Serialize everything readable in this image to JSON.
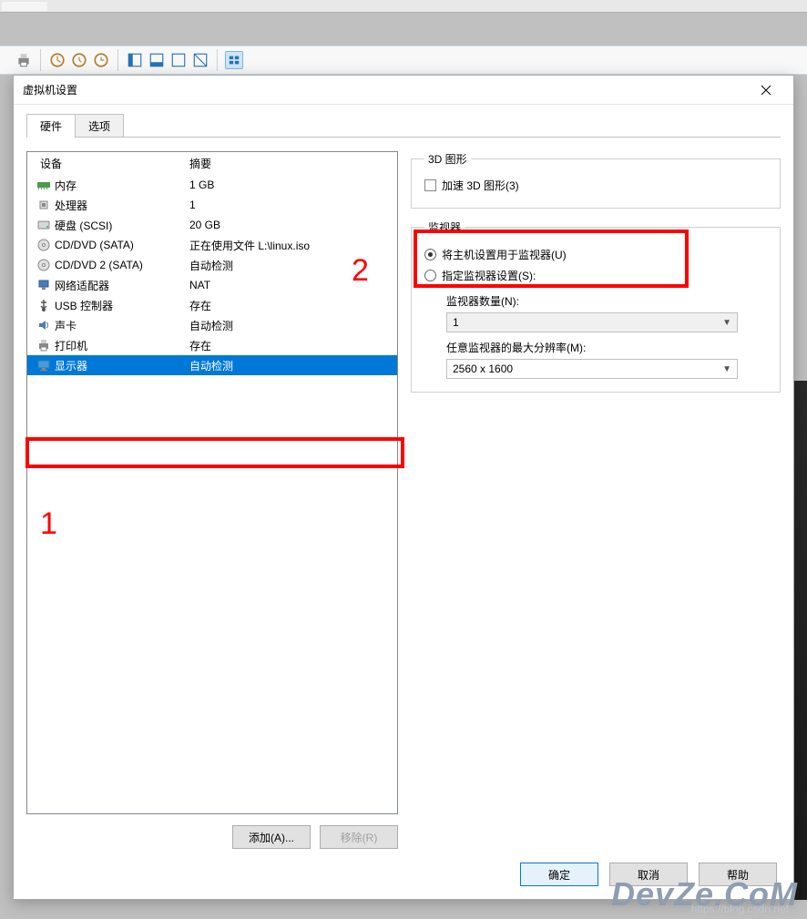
{
  "dialog": {
    "title": "虚拟机设置"
  },
  "tabs": {
    "hardware": "硬件",
    "options": "选项"
  },
  "headers": {
    "device": "设备",
    "summary": "摘要"
  },
  "devices": [
    {
      "name": "内存",
      "summary": "1 GB",
      "icon": "memory"
    },
    {
      "name": "处理器",
      "summary": "1",
      "icon": "cpu"
    },
    {
      "name": "硬盘 (SCSI)",
      "summary": "20 GB",
      "icon": "disk"
    },
    {
      "name": "CD/DVD (SATA)",
      "summary": "正在使用文件 L:\\linux.iso",
      "icon": "cd"
    },
    {
      "name": "CD/DVD 2 (SATA)",
      "summary": "自动检测",
      "icon": "cd"
    },
    {
      "name": "网络适配器",
      "summary": "NAT",
      "icon": "net"
    },
    {
      "name": "USB 控制器",
      "summary": "存在",
      "icon": "usb"
    },
    {
      "name": "声卡",
      "summary": "自动检测",
      "icon": "sound"
    },
    {
      "name": "打印机",
      "summary": "存在",
      "icon": "printer"
    },
    {
      "name": "显示器",
      "summary": "自动检测",
      "icon": "display",
      "selected": true
    }
  ],
  "buttons": {
    "add": "添加(A)...",
    "remove": "移除(R)",
    "ok": "确定",
    "cancel": "取消",
    "help": "帮助"
  },
  "graphics3d": {
    "legend": "3D 图形",
    "accel": "加速 3D 图形(3)"
  },
  "monitor": {
    "legend": "监视器",
    "use_host": "将主机设置用于监视器(U)",
    "specify": "指定监视器设置(S):",
    "count_label": "监视器数量(N):",
    "count_value": "1",
    "maxres_label": "任意监视器的最大分辨率(M):",
    "maxres_value": "2560 x 1600"
  },
  "annotations": {
    "one": "1",
    "two": "2"
  },
  "watermark": {
    "brand": "DevZe.CoM",
    "url": "https://blog.csdn.net"
  }
}
